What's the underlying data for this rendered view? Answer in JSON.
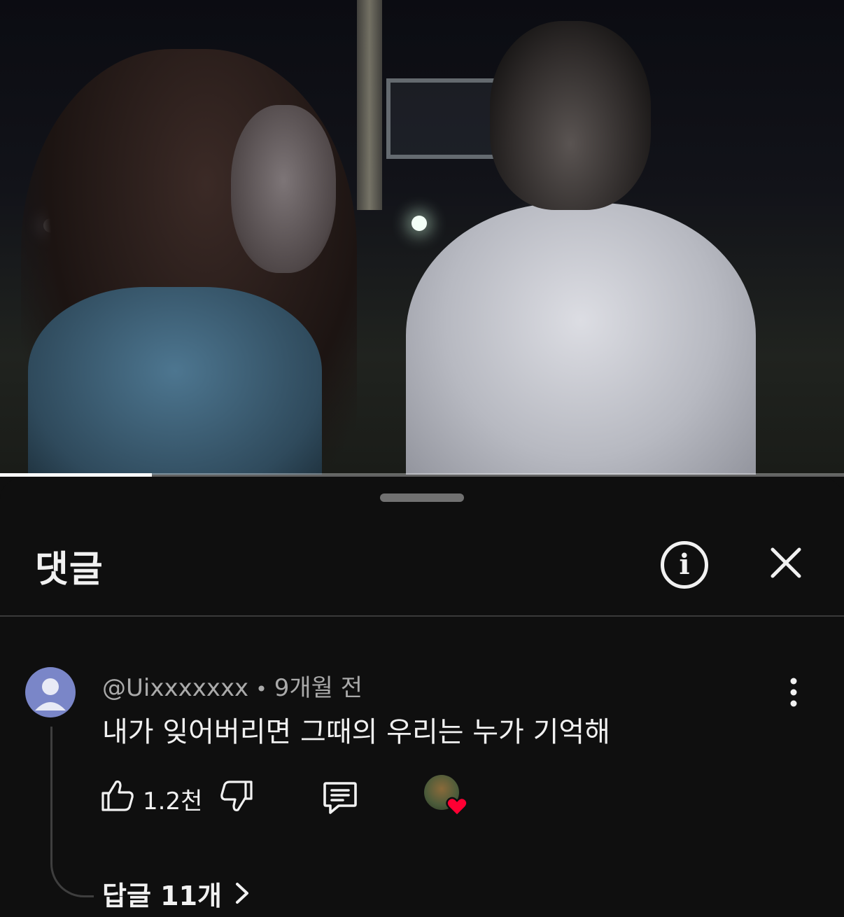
{
  "video": {
    "progress_fraction": 0.18
  },
  "panel": {
    "title": "댓글",
    "info_icon": "info-icon",
    "close_icon": "close-icon"
  },
  "comment": {
    "author": "@Uixxxxxxx",
    "separator": "•",
    "time_ago": "9개월 전",
    "text": "내가 잊어버리면 그때의 우리는 누가 기억해",
    "like_count": "1.2천",
    "replies_label": "답글 11개",
    "icons": {
      "like": "thumbs-up-icon",
      "dislike": "thumbs-down-icon",
      "reply": "reply-icon",
      "more": "more-vert-icon",
      "creator_heart": "creator-heart-icon",
      "chevron": "chevron-right-icon"
    }
  },
  "colors": {
    "background": "#0f0f0f",
    "text_primary": "#f1f1f1",
    "text_secondary": "#aaaaaa",
    "avatar": "#7a86c8",
    "heart": "#ff0033"
  }
}
